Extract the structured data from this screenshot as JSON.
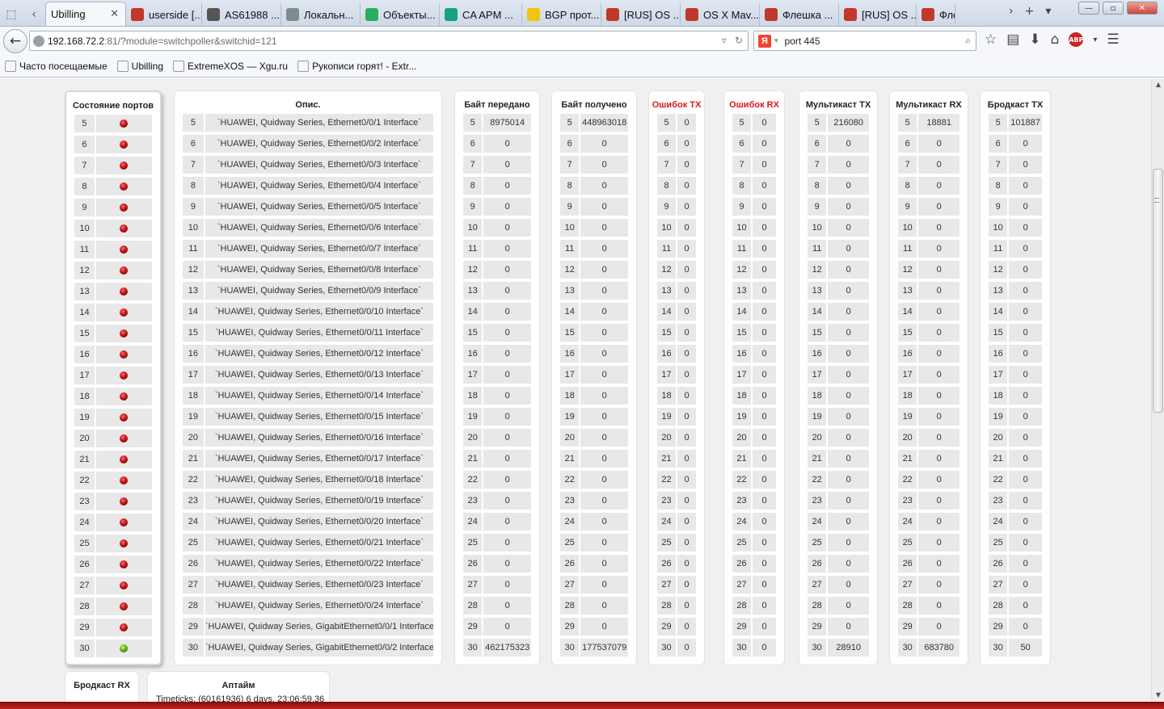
{
  "browser": {
    "tabs": [
      {
        "label": "Ubilling",
        "active": true,
        "icon": "none",
        "color": ""
      },
      {
        "label": "userside [...",
        "icon": "feather-icon",
        "color": "#c0392b"
      },
      {
        "label": "AS61988 ...",
        "icon": "he-icon",
        "color": "#555555"
      },
      {
        "label": "Локальн...",
        "icon": "tool-icon",
        "color": "#7f8c8d"
      },
      {
        "label": "Объекты...",
        "icon": "object-icon",
        "color": "#27ae60"
      },
      {
        "label": "CA APM ...",
        "icon": "ca-icon",
        "color": "#16a085"
      },
      {
        "label": "BGP прот...",
        "icon": "star-icon",
        "color": "#f1c40f"
      },
      {
        "label": "[RUS] OS ...",
        "icon": "bug-icon",
        "color": "#c0392b"
      },
      {
        "label": "OS X Mav...",
        "icon": "bug-icon",
        "color": "#c0392b"
      },
      {
        "label": "Флешка ...",
        "icon": "bug-icon",
        "color": "#c0392b"
      },
      {
        "label": "[RUS] OS ...",
        "icon": "bug-icon",
        "color": "#c0392b"
      },
      {
        "label": "Флеш",
        "icon": "bug-icon",
        "color": "#c0392b"
      }
    ],
    "url_host": "192.168.72.2",
    "url_path": ":81/?module=switchpoller&switchid=121",
    "search_value": "port 445",
    "bookmarks": [
      {
        "label": "Часто посещаемые",
        "icon": "mozilla-icon"
      },
      {
        "label": "Ubilling",
        "icon": "page-icon"
      },
      {
        "label": "ExtremeXOS — Xgu.ru",
        "icon": "xgu-icon"
      },
      {
        "label": "Рукописи горят! - Extr...",
        "icon": "user-icon"
      }
    ]
  },
  "ports": [
    5,
    6,
    7,
    8,
    9,
    10,
    11,
    12,
    13,
    14,
    15,
    16,
    17,
    18,
    19,
    20,
    21,
    22,
    23,
    24,
    25,
    26,
    27,
    28,
    29,
    30
  ],
  "columns": {
    "status": {
      "title": "Состояние портов",
      "values": [
        "down",
        "down",
        "down",
        "down",
        "down",
        "down",
        "down",
        "down",
        "down",
        "down",
        "down",
        "down",
        "down",
        "down",
        "down",
        "down",
        "down",
        "down",
        "down",
        "down",
        "down",
        "down",
        "down",
        "down",
        "down",
        "up"
      ]
    },
    "desc": {
      "title": "Опис.",
      "values": [
        "`HUAWEI, Quidway Series, Ethernet0/0/1 Interface`",
        "`HUAWEI, Quidway Series, Ethernet0/0/2 Interface`",
        "`HUAWEI, Quidway Series, Ethernet0/0/3 Interface`",
        "`HUAWEI, Quidway Series, Ethernet0/0/4 Interface`",
        "`HUAWEI, Quidway Series, Ethernet0/0/5 Interface`",
        "`HUAWEI, Quidway Series, Ethernet0/0/6 Interface`",
        "`HUAWEI, Quidway Series, Ethernet0/0/7 Interface`",
        "`HUAWEI, Quidway Series, Ethernet0/0/8 Interface`",
        "`HUAWEI, Quidway Series, Ethernet0/0/9 Interface`",
        "`HUAWEI, Quidway Series, Ethernet0/0/10 Interface`",
        "`HUAWEI, Quidway Series, Ethernet0/0/11 Interface`",
        "`HUAWEI, Quidway Series, Ethernet0/0/12 Interface`",
        "`HUAWEI, Quidway Series, Ethernet0/0/13 Interface`",
        "`HUAWEI, Quidway Series, Ethernet0/0/14 Interface`",
        "`HUAWEI, Quidway Series, Ethernet0/0/15 Interface`",
        "`HUAWEI, Quidway Series, Ethernet0/0/16 Interface`",
        "`HUAWEI, Quidway Series, Ethernet0/0/17 Interface`",
        "`HUAWEI, Quidway Series, Ethernet0/0/18 Interface`",
        "`HUAWEI, Quidway Series, Ethernet0/0/19 Interface`",
        "`HUAWEI, Quidway Series, Ethernet0/0/20 Interface`",
        "`HUAWEI, Quidway Series, Ethernet0/0/21 Interface`",
        "`HUAWEI, Quidway Series, Ethernet0/0/22 Interface`",
        "`HUAWEI, Quidway Series, Ethernet0/0/23 Interface`",
        "`HUAWEI, Quidway Series, Ethernet0/0/24 Interface`",
        "`HUAWEI, Quidway Series, GigabitEthernet0/0/1 Interface`",
        "`HUAWEI, Quidway Series, GigabitEthernet0/0/2 Interface`"
      ]
    },
    "bytes_tx": {
      "title": "Байт передано",
      "values": [
        "8975014",
        "0",
        "0",
        "0",
        "0",
        "0",
        "0",
        "0",
        "0",
        "0",
        "0",
        "0",
        "0",
        "0",
        "0",
        "0",
        "0",
        "0",
        "0",
        "0",
        "0",
        "0",
        "0",
        "0",
        "0",
        "462175323"
      ]
    },
    "bytes_rx": {
      "title": "Байт получено",
      "values": [
        "448963018",
        "0",
        "0",
        "0",
        "0",
        "0",
        "0",
        "0",
        "0",
        "0",
        "0",
        "0",
        "0",
        "0",
        "0",
        "0",
        "0",
        "0",
        "0",
        "0",
        "0",
        "0",
        "0",
        "0",
        "0",
        "177537079"
      ]
    },
    "errors_tx": {
      "title": "Ошибок TX",
      "values": [
        "0",
        "0",
        "0",
        "0",
        "0",
        "0",
        "0",
        "0",
        "0",
        "0",
        "0",
        "0",
        "0",
        "0",
        "0",
        "0",
        "0",
        "0",
        "0",
        "0",
        "0",
        "0",
        "0",
        "0",
        "0",
        "0"
      ]
    },
    "errors_rx": {
      "title": "Ошибок RX",
      "values": [
        "0",
        "0",
        "0",
        "0",
        "0",
        "0",
        "0",
        "0",
        "0",
        "0",
        "0",
        "0",
        "0",
        "0",
        "0",
        "0",
        "0",
        "0",
        "0",
        "0",
        "0",
        "0",
        "0",
        "0",
        "0",
        "0"
      ]
    },
    "multicast_tx": {
      "title": "Мультикаст TX",
      "values": [
        "216080",
        "0",
        "0",
        "0",
        "0",
        "0",
        "0",
        "0",
        "0",
        "0",
        "0",
        "0",
        "0",
        "0",
        "0",
        "0",
        "0",
        "0",
        "0",
        "0",
        "0",
        "0",
        "0",
        "0",
        "0",
        "28910"
      ]
    },
    "multicast_rx": {
      "title": "Мультикаст RX",
      "values": [
        "18881",
        "0",
        "0",
        "0",
        "0",
        "0",
        "0",
        "0",
        "0",
        "0",
        "0",
        "0",
        "0",
        "0",
        "0",
        "0",
        "0",
        "0",
        "0",
        "0",
        "0",
        "0",
        "0",
        "0",
        "0",
        "683780"
      ]
    },
    "broadcast_tx": {
      "title": "Бродкаст TX",
      "values": [
        "101887",
        "0",
        "0",
        "0",
        "0",
        "0",
        "0",
        "0",
        "0",
        "0",
        "0",
        "0",
        "0",
        "0",
        "0",
        "0",
        "0",
        "0",
        "0",
        "0",
        "0",
        "0",
        "0",
        "0",
        "0",
        "50"
      ]
    }
  },
  "bottom": {
    "broadcast_rx_title": "Бродкаст RX",
    "uptime_title": "Аптайм",
    "uptime_value": "Timeticks: (60161936) 6 days, 23:06:59.36"
  },
  "colors": {
    "error_header": "#e0161b",
    "port_down": "#c01414",
    "port_up": "#62b20e"
  }
}
